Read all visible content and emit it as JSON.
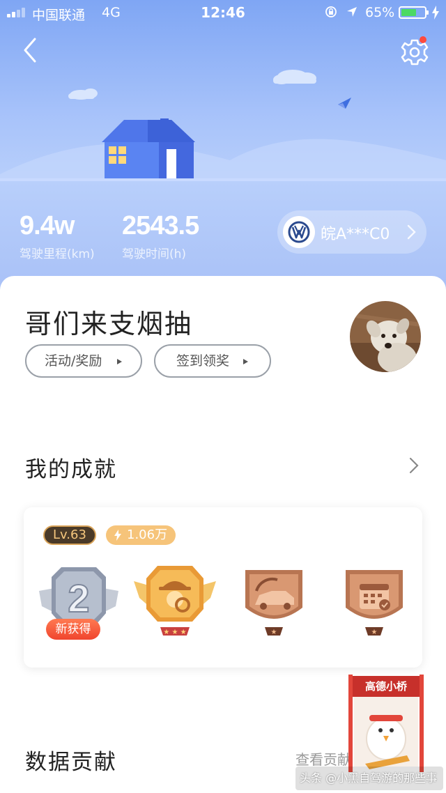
{
  "status_bar": {
    "carrier": "中国联通",
    "network": "4G",
    "time": "12:46",
    "battery_percent": "65%",
    "battery_level": 0.65
  },
  "header": {
    "back_icon": "chevron-left-icon",
    "settings_icon": "gear-icon"
  },
  "stats": [
    {
      "value": "9.4w",
      "label": "驾驶里程(km)"
    },
    {
      "value": "2543.5",
      "label": "驾驶时间(h)"
    }
  ],
  "car": {
    "plate": "皖A***C0",
    "logo_icon": "volkswagen-logo"
  },
  "profile": {
    "username": "哥们来支烟抽",
    "buttons": [
      {
        "label": "活动/奖励"
      },
      {
        "label": "签到领奖"
      }
    ]
  },
  "achievements": {
    "title": "我的成就",
    "level": "Lv.63",
    "points": "1.06万",
    "new_badge_text": "新获得",
    "medals": [
      {
        "icon": "silver-rank-2-medal-icon"
      },
      {
        "icon": "explorer-gold-medal-icon"
      },
      {
        "icon": "car-bronze-medal-icon"
      },
      {
        "icon": "calendar-bronze-medal-icon"
      }
    ]
  },
  "data_contribution": {
    "title": "数据贡献",
    "link": "查看贡献"
  },
  "promo": {
    "title": "高德小桥"
  },
  "watermark": "头条 @小黑自驾游的那些事",
  "colors": {
    "hero_blue": "#8bb0f6",
    "medal_gold": "#f3b24a",
    "medal_bronze": "#c98a62",
    "new_tag_red": "#f0452e"
  }
}
